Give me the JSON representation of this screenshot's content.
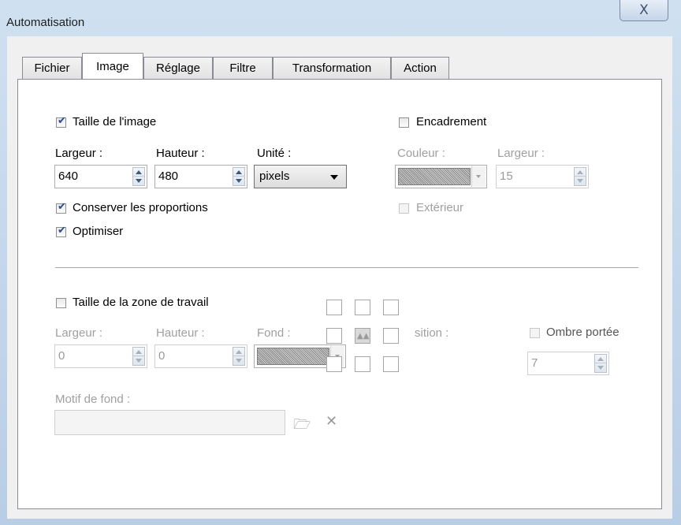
{
  "window": {
    "title": "Automatisation",
    "close_glyph": "X"
  },
  "tabs": [
    {
      "label": "Fichier"
    },
    {
      "label": "Image"
    },
    {
      "label": "Réglage"
    },
    {
      "label": "Filtre"
    },
    {
      "label": "Transformation"
    },
    {
      "label": "Action"
    }
  ],
  "image_size": {
    "checkbox_label": "Taille de l'image",
    "checked": true,
    "width_label": "Largeur :",
    "width_value": "640",
    "height_label": "Hauteur :",
    "height_value": "480",
    "unit_label": "Unité :",
    "unit_value": "pixels",
    "keep_ratio_label": "Conserver les proportions",
    "keep_ratio_checked": true,
    "optimize_label": "Optimiser",
    "optimize_checked": true
  },
  "frame": {
    "checkbox_label": "Encadrement",
    "checked": false,
    "color_label": "Couleur :",
    "width_label": "Largeur :",
    "width_value": "15",
    "outside_label": "Extérieur",
    "outside_checked": false
  },
  "canvas": {
    "checkbox_label": "Taille de la zone de travail",
    "checked": false,
    "width_label": "Largeur :",
    "width_value": "0",
    "height_label": "Hauteur :",
    "height_value": "0",
    "background_label": "Fond :",
    "position_label": "sition :",
    "shadow_label": "Ombre portée",
    "shadow_checked": false,
    "shadow_value": "7",
    "pattern_label": "Motif de fond :",
    "pattern_value": ""
  },
  "icons": {
    "browse": "folder-open-icon",
    "clear": "close-x-icon",
    "anchor": "image-anchor-icon"
  }
}
